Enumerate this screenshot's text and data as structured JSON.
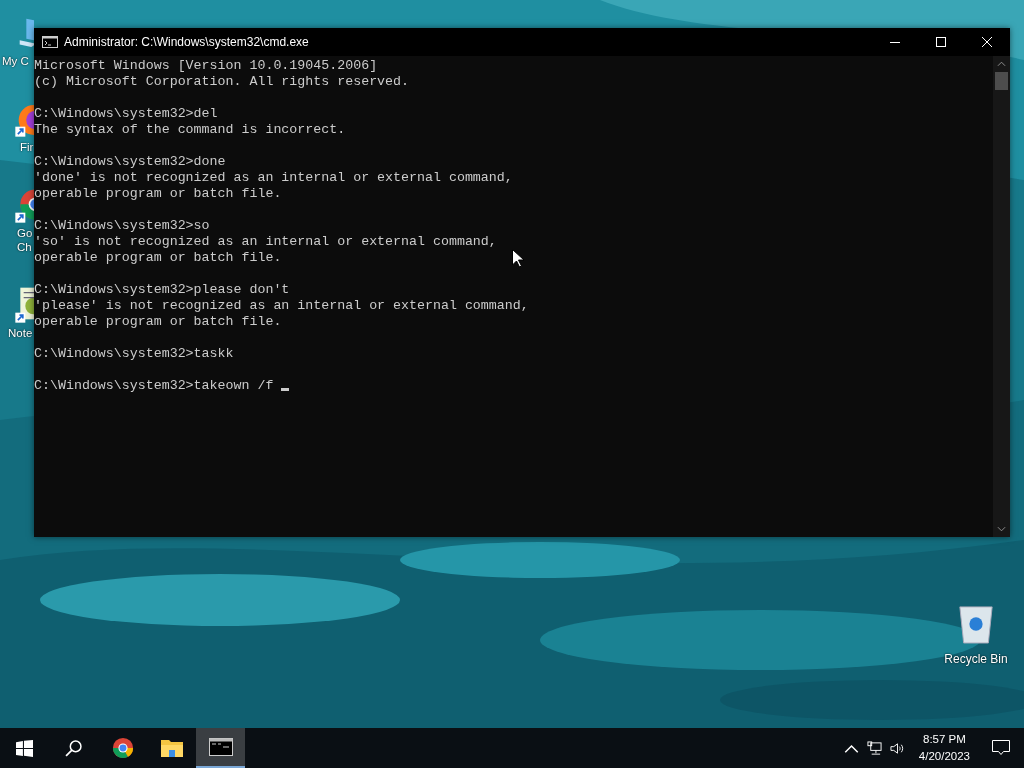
{
  "desktop_icons": [
    {
      "kind": "computer",
      "label": [
        "My C"
      ]
    },
    {
      "kind": "firefox",
      "label": [
        "Fir"
      ]
    },
    {
      "kind": "chrome",
      "label": [
        "Go",
        "Ch"
      ]
    },
    {
      "kind": "notepad",
      "label": [
        "Note"
      ]
    }
  ],
  "recycle_bin": {
    "label": "Recycle Bin"
  },
  "window": {
    "title": "Administrator: C:\\Windows\\system32\\cmd.exe",
    "console": {
      "blocks": [
        [
          "Microsoft Windows [Version 10.0.19045.2006]",
          "(c) Microsoft Corporation. All rights reserved."
        ],
        [
          "C:\\Windows\\system32>del",
          "The syntax of the command is incorrect."
        ],
        [
          "C:\\Windows\\system32>done",
          "'done' is not recognized as an internal or external command,",
          "operable program or batch file."
        ],
        [
          "C:\\Windows\\system32>so",
          "'so' is not recognized as an internal or external command,",
          "operable program or batch file."
        ],
        [
          "C:\\Windows\\system32>please don't",
          "'please' is not recognized as an internal or external command,",
          "operable program or batch file."
        ],
        [
          "C:\\Windows\\system32>taskk"
        ],
        [
          "C:\\Windows\\system32>takeown /f "
        ]
      ],
      "cursor": true
    }
  },
  "taskbar": {
    "buttons": [
      {
        "kind": "start",
        "selected": false
      },
      {
        "kind": "search",
        "selected": false
      },
      {
        "kind": "chrome",
        "selected": false
      },
      {
        "kind": "explorer",
        "selected": false
      },
      {
        "kind": "cmd",
        "selected": true
      }
    ],
    "tray": {
      "time": "8:57 PM",
      "date": "4/20/2023"
    }
  }
}
